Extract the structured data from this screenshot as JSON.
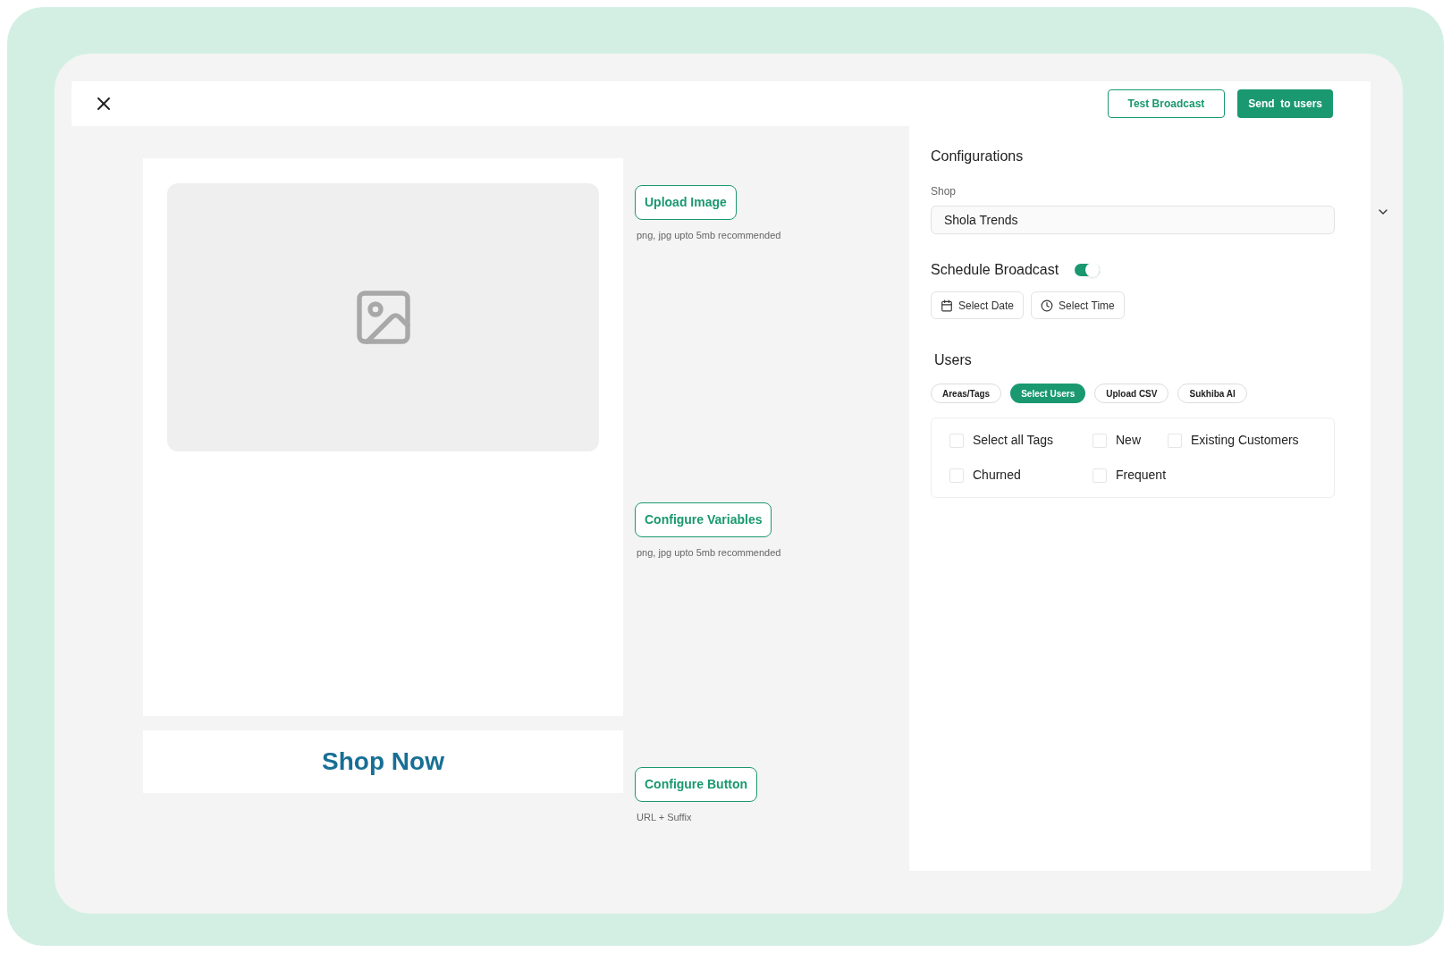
{
  "header": {
    "buttons": [
      {
        "label": "Test Broadcast",
        "kind": "outline"
      },
      {
        "label": "Send  to users",
        "kind": "filled"
      }
    ]
  },
  "preview": {
    "image": {
      "kind": "placeholder"
    },
    "cta": "Shop Now"
  },
  "actions": [
    {
      "label": "Upload Image",
      "hint": "png, jpg upto 5mb recommended"
    },
    {
      "label": "Configure Variables",
      "hint": "png, jpg upto 5mb recommended"
    },
    {
      "label": "Configure Button",
      "hint": "URL + Suffix"
    }
  ],
  "configurations": {
    "title": "Configurations",
    "shop": {
      "label": "Shop",
      "value": "Shola Trends"
    },
    "schedule": {
      "label": "Schedule Broadcast",
      "on": true,
      "date": "Select Date",
      "time": "Select Time"
    },
    "users": {
      "title": "Users",
      "tabs": [
        {
          "label": "Areas/Tags",
          "selected": false
        },
        {
          "label": "Select Users",
          "selected": true
        },
        {
          "label": "Upload CSV",
          "selected": false
        },
        {
          "label": "Sukhiba AI",
          "selected": false
        }
      ],
      "tags": [
        {
          "label": "Select all Tags",
          "checked": false
        },
        {
          "label": "New",
          "checked": false
        },
        {
          "label": "Existing Customers",
          "checked": false
        },
        {
          "label": "Churned",
          "checked": false
        },
        {
          "label": "Frequent",
          "checked": false
        }
      ]
    }
  }
}
